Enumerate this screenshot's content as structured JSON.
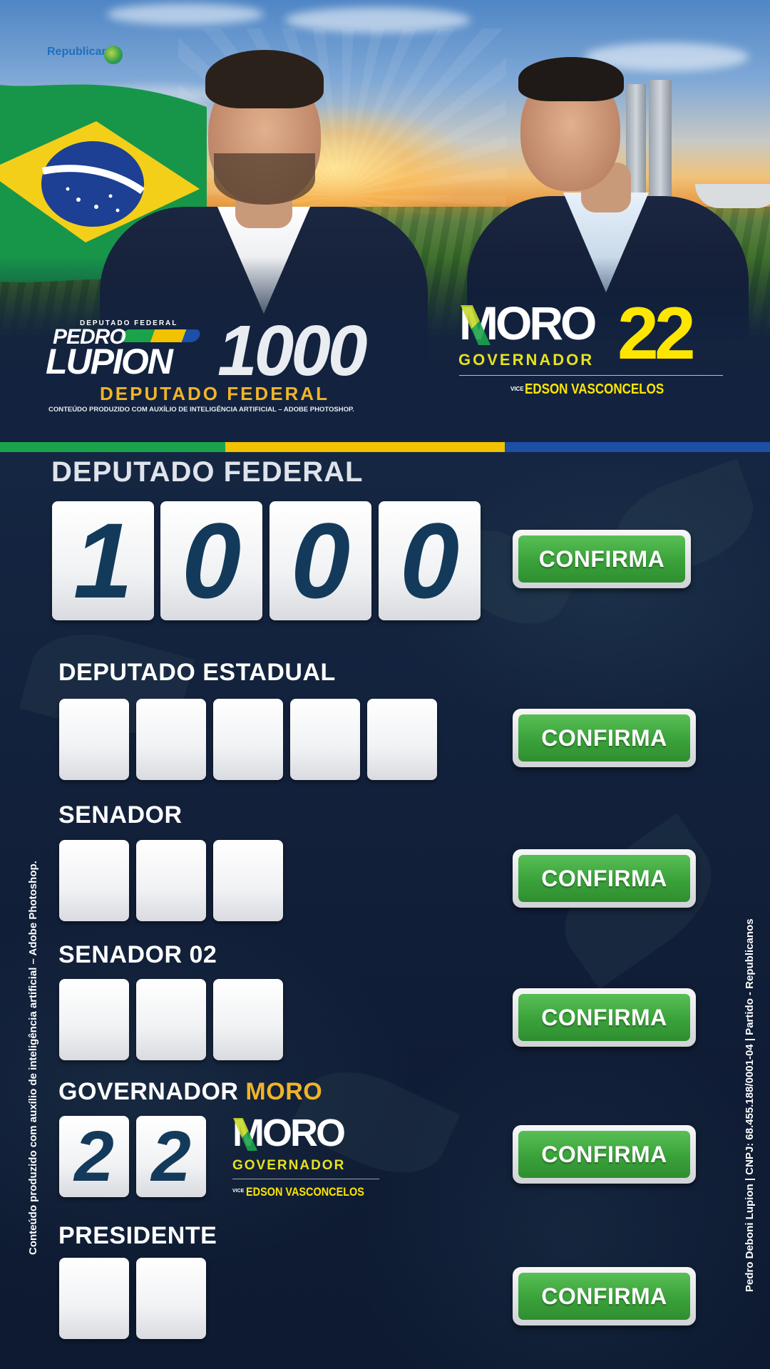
{
  "party": {
    "name": "Republicanos"
  },
  "lupion": {
    "small_label": "DEPUTADO FEDERAL",
    "first_name": "PEDRO",
    "last_name": "LUPION",
    "number": "1000",
    "role": "DEPUTADO FEDERAL",
    "disclaimer": "CONTEÚDO PRODUZIDO COM AUXÍLIO DE INTELIGÊNCIA ARTIFICIAL – ADOBE PHOTOSHOP."
  },
  "moro": {
    "name": "MORO",
    "role": "GOVERNADOR",
    "number": "22",
    "vice_label": "VICE",
    "vice_name": "EDSON VASCONCELOS"
  },
  "colors": {
    "green": "#1aa34a",
    "yellow": "#f2c200",
    "blue": "#1c4fa6",
    "navy": "#13233f",
    "gold": "#f0b429",
    "confirm_green": "#3aa23a"
  },
  "ballot": {
    "confirm_label": "CONFIRMA",
    "sections": [
      {
        "label": "DEPUTADO FEDERAL",
        "digits": [
          "1",
          "0",
          "0",
          "0"
        ]
      },
      {
        "label": "DEPUTADO ESTADUAL",
        "digits": [
          "",
          "",
          "",
          "",
          ""
        ]
      },
      {
        "label": "SENADOR",
        "digits": [
          "",
          "",
          ""
        ]
      },
      {
        "label": "SENADOR 02",
        "digits": [
          "",
          "",
          ""
        ]
      },
      {
        "label": "GOVERNADOR",
        "label_highlight": "MORO",
        "digits": [
          "2",
          "2"
        ]
      },
      {
        "label": "PRESIDENTE",
        "digits": [
          "",
          ""
        ]
      }
    ]
  },
  "side_text": {
    "left": "Conteúdo produzido com auxílio de inteligência artificial – Adobe Photoshop.",
    "right": "Pedro Deboni Lupion | CNPJ: 68.455.188/0001-04 | Partido - Republicanos"
  }
}
